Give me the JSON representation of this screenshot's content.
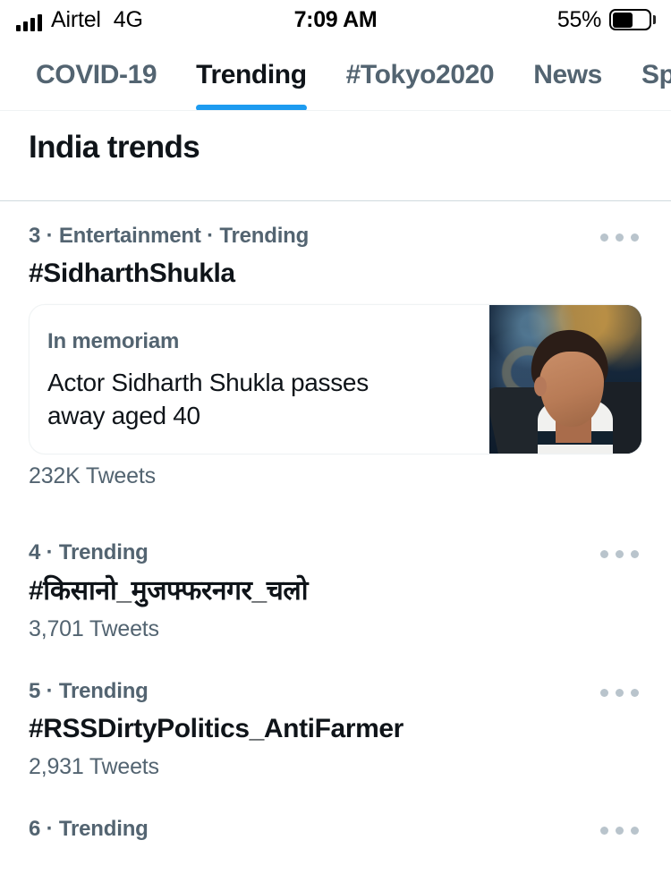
{
  "status_bar": {
    "carrier": "Airtel",
    "network": "4G",
    "time": "7:09 AM",
    "battery_percent": "55%",
    "signal_icon": "signal-bars-icon",
    "battery_icon": "battery-icon"
  },
  "tabs": [
    {
      "label": "COVID-19",
      "active": false
    },
    {
      "label": "Trending",
      "active": true
    },
    {
      "label": "#Tokyo2020",
      "active": false
    },
    {
      "label": "News",
      "active": false
    },
    {
      "label": "Sp",
      "active": false
    }
  ],
  "header": {
    "title": "India trends"
  },
  "clipped_top_item": "",
  "trends": [
    {
      "meta": "3 · Entertainment · Trending",
      "name": "#SidharthShukla",
      "count": "232K Tweets",
      "card": {
        "kicker": "In memoriam",
        "headline": "Actor Sidharth Shukla passes away aged 40",
        "thumbnail": "sidharth-shukla-photo"
      },
      "menu_icon": "more-options-icon"
    },
    {
      "meta": "4 · Trending",
      "name": "#किसानो_मुजफ्फरनगर_चलो",
      "count": "3,701 Tweets",
      "menu_icon": "more-options-icon"
    },
    {
      "meta": "5 · Trending",
      "name": "#RSSDirtyPolitics_AntiFarmer",
      "count": "2,931 Tweets",
      "menu_icon": "more-options-icon"
    },
    {
      "meta": "6 · Trending",
      "name": "",
      "count": "",
      "menu_icon": "more-options-icon"
    }
  ],
  "colors": {
    "accent": "#1d9bf0",
    "text_primary": "#0f1419",
    "text_secondary": "#536471",
    "divider": "#cfd9de",
    "card_border": "#eff3f4"
  }
}
